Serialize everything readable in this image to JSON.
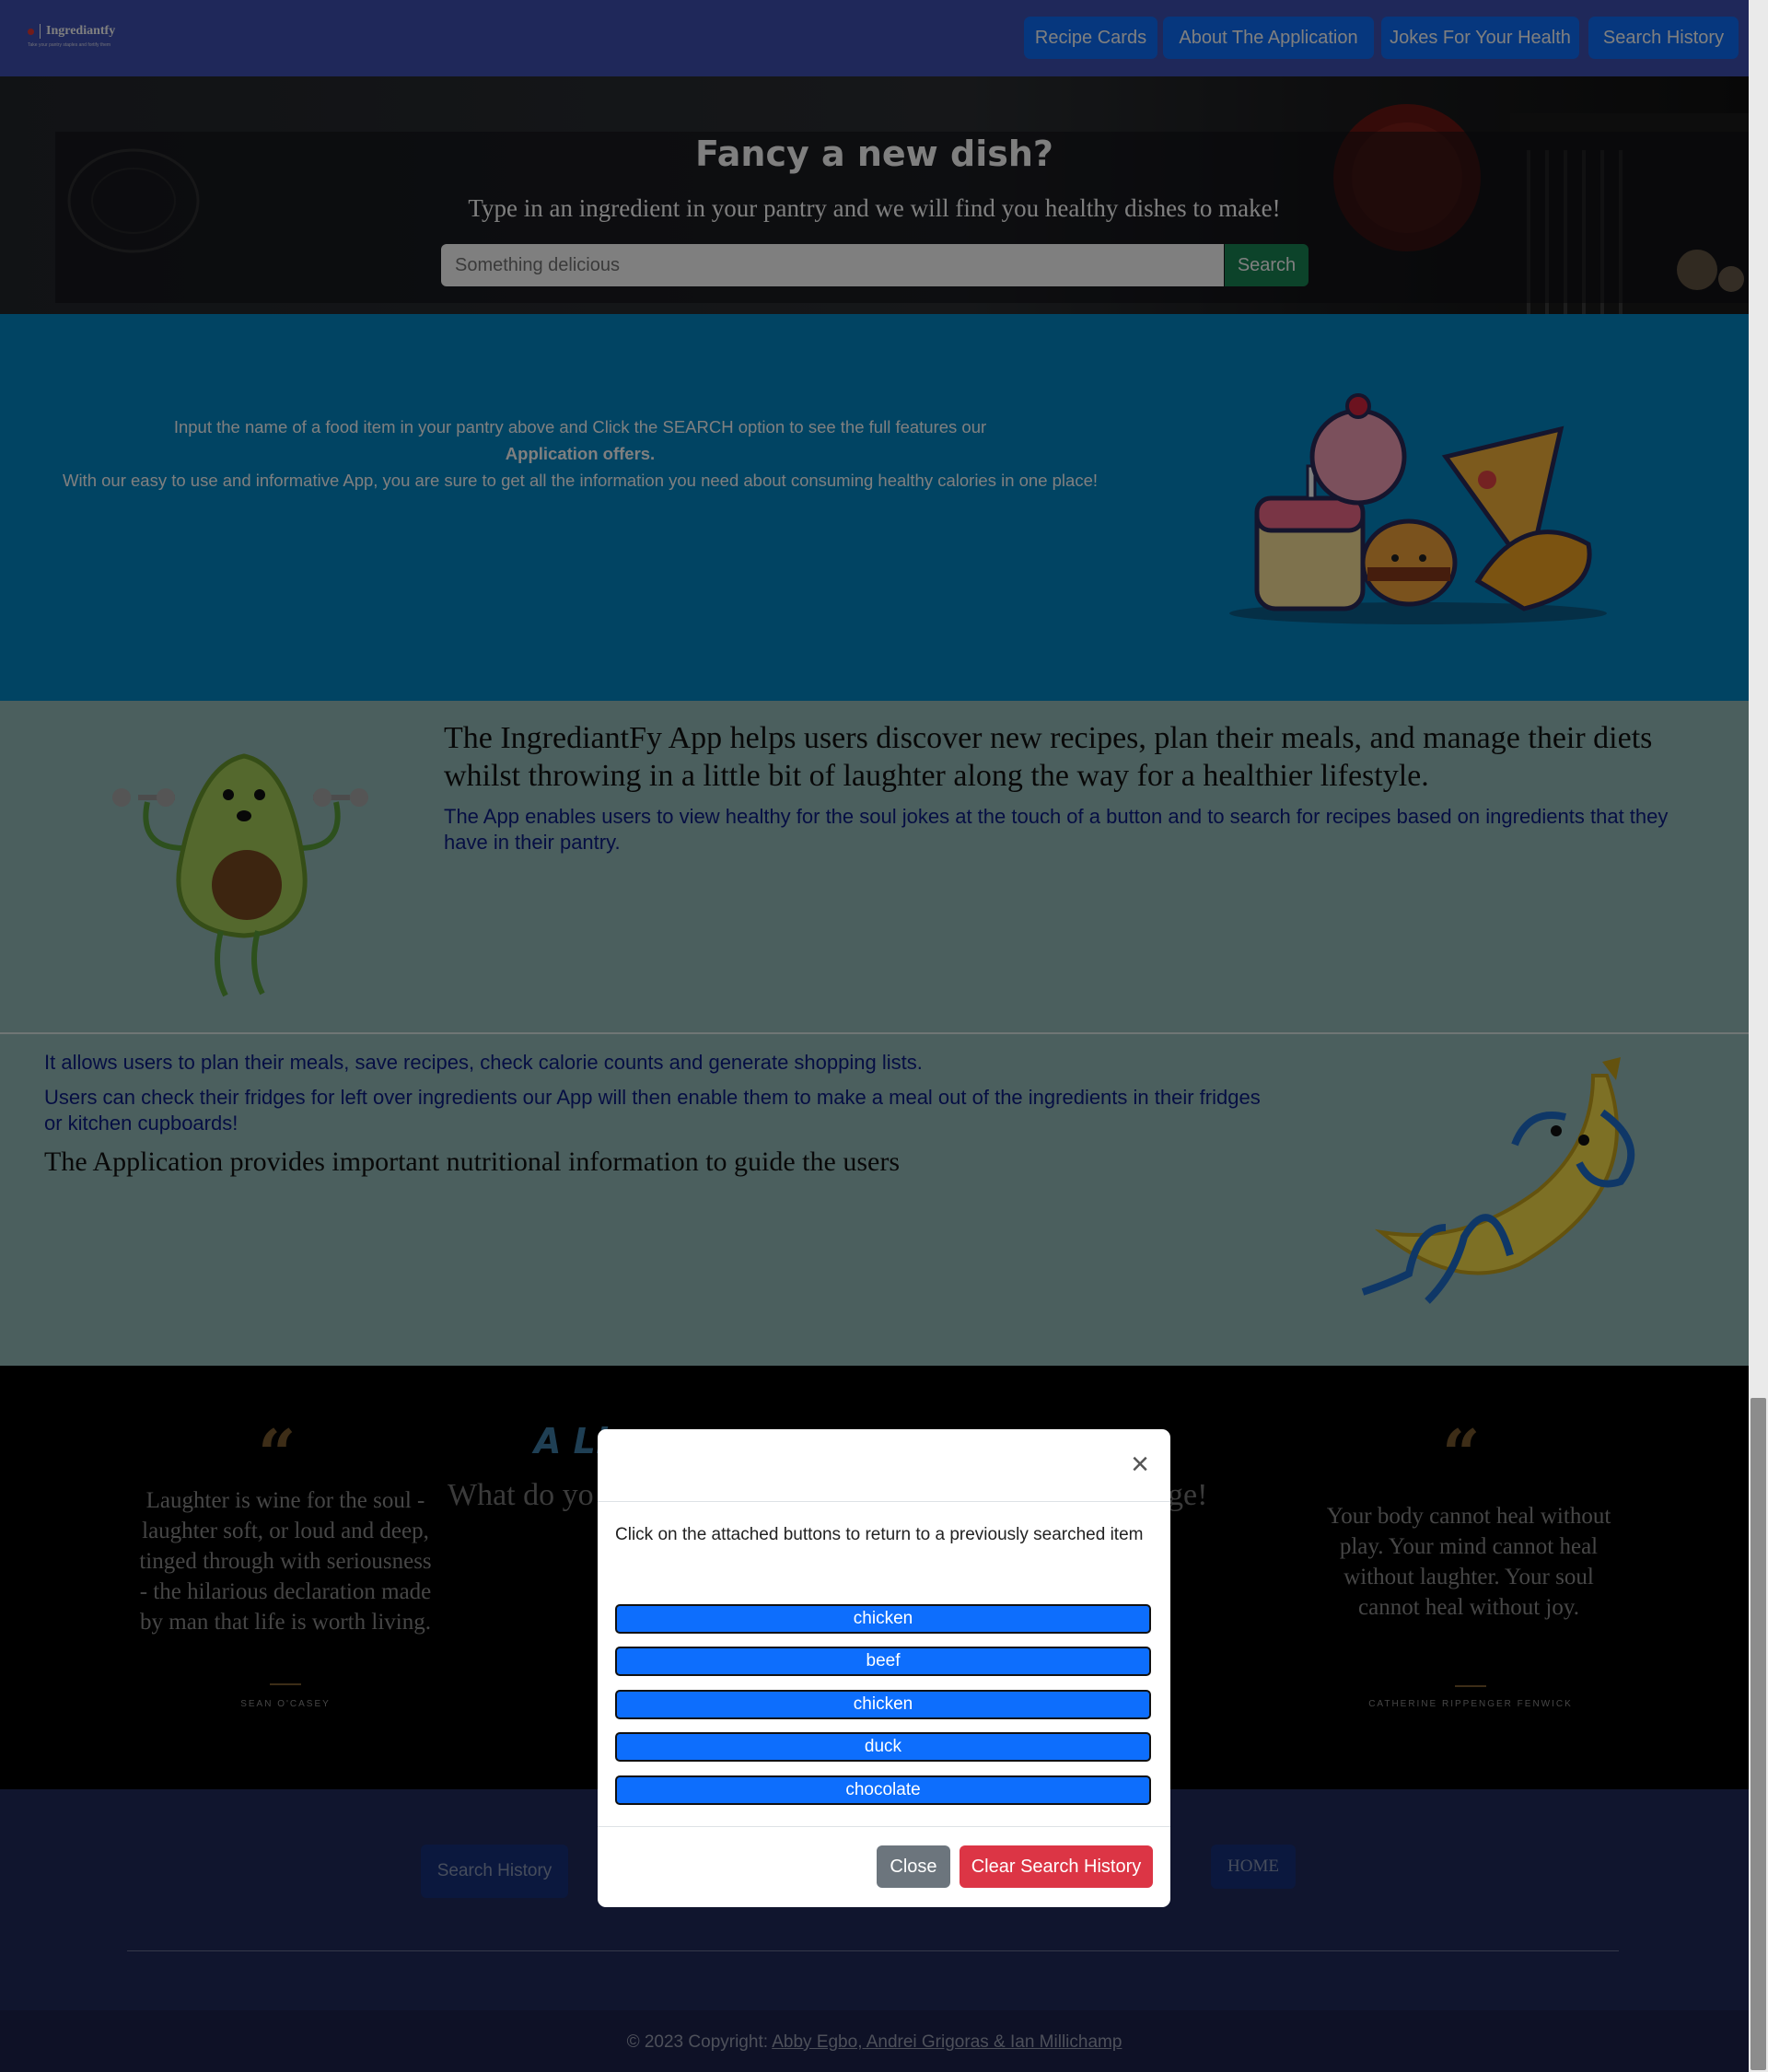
{
  "brand": {
    "name": "Ingrediantfy",
    "tagline": "Take your pantry staples and fortify them"
  },
  "nav": {
    "items": [
      {
        "label": "Recipe Cards"
      },
      {
        "label": "About The Application"
      },
      {
        "label": "Jokes For Your Health"
      },
      {
        "label": "Search History"
      }
    ]
  },
  "hero": {
    "title": "Fancy a new dish?",
    "subtitle": "Type in an ingredient in your pantry and we will find you healthy dishes to make!",
    "search_placeholder": "Something delicious",
    "search_button": "Search"
  },
  "intro": {
    "line1": "Input the name of a food item in your pantry above and Click the SEARCH option to see the full features our",
    "line1_bold": "Application offers.",
    "line2": "With our easy to use and informative App, you are sure to get all the information you need about consuming healthy calories in one place!"
  },
  "about": {
    "heading": "The IngrediantFy App helps users discover new recipes, plan their meals, and manage their diets whilst throwing in a little bit of laughter along the way for a healthier lifestyle.",
    "body": "The App enables users to view healthy for the soul jokes at the touch of a button and to search for recipes based on ingredients that they have in their pantry."
  },
  "features": {
    "line1": "It allows users to plan their meals, save recipes, check calorie counts and generate shopping lists.",
    "line2": "Users can check their fridges for left over ingredients our App will then enable them to make a meal out of the ingredients in their fridges or kitchen cupboards!",
    "line3": "The Application provides important nutritional information to guide the users"
  },
  "quotes": {
    "left": {
      "mark": "“",
      "text": "Laughter is wine for the soul - laughter soft, or loud and deep, tinged through with seriousness - the hilarious declaration made by man that life is worth living.",
      "author": "SEAN O'CASEY"
    },
    "right": {
      "mark": "“",
      "text": "Your body cannot heal without play. Your mind cannot heal without laughter. Your soul cannot heal without joy.",
      "author": "CATHERINE RIPPENGER FENWICK"
    },
    "center_title_partial": "A Li",
    "center_subtitle_left": "What do yo",
    "center_subtitle_right": "ge!"
  },
  "footer": {
    "search_history_button": "Search History",
    "home_button": "HOME",
    "copyright_prefix": "© 2023 Copyright: ",
    "copyright_authors": "Abby Egbo, Andrei Grigoras & Ian Millichamp"
  },
  "modal": {
    "close_icon": "×",
    "text": "Click on the attached buttons to return to a previously searched item",
    "history": [
      "chicken",
      "beef",
      "chicken",
      "duck",
      "chocolate"
    ],
    "close_button": "Close",
    "clear_button": "Clear Search History"
  },
  "colors": {
    "navbar": "#3f51b5",
    "primary": "#0d6efd",
    "success": "#198754",
    "danger": "#dc3545",
    "secondary": "#6c757d",
    "intro_bg": "#0288c7",
    "about_bg": "#96bfbd",
    "about_text": "#0c1d87",
    "footer_bg": "#212a5c"
  },
  "icons": {
    "brand": "brand-dot-icon",
    "close": "close-icon",
    "illustrations": [
      "food-characters-illustration",
      "avocado-lifting-illustration",
      "banana-relaxing-illustration"
    ]
  }
}
